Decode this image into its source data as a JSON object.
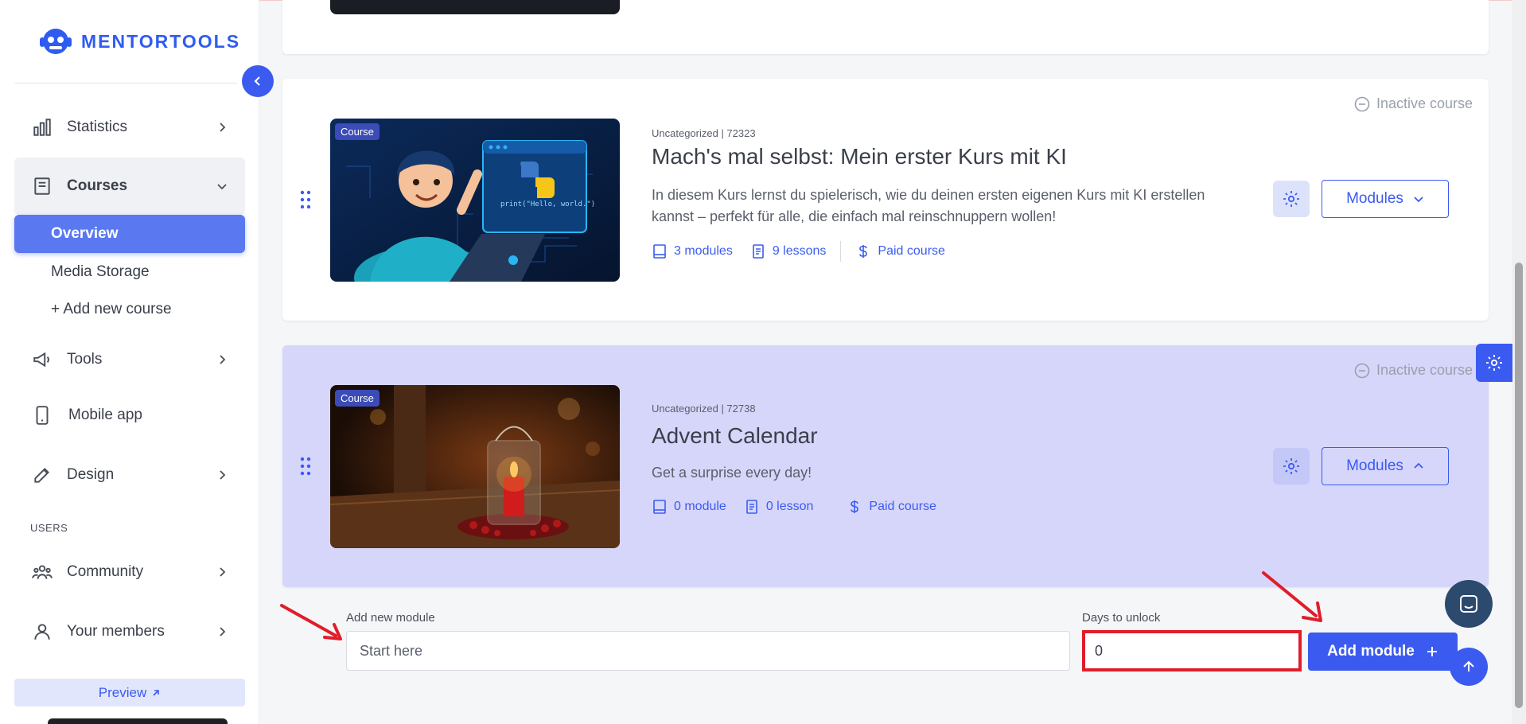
{
  "brand": {
    "name": "MENTORTOOLS",
    "color": "#2f5cf0"
  },
  "sidebar": {
    "items": [
      {
        "label": "Statistics",
        "icon": "bar-chart-icon"
      },
      {
        "label": "Courses",
        "icon": "book-icon"
      },
      {
        "label": "Tools",
        "icon": "megaphone-icon"
      },
      {
        "label": "Mobile app",
        "icon": "smartphone-icon"
      },
      {
        "label": "Design",
        "icon": "pencil-icon"
      },
      {
        "label": "Community",
        "icon": "users-icon"
      },
      {
        "label": "Your members",
        "icon": "user-icon"
      }
    ],
    "courses_sub": {
      "overview": "Overview",
      "media_storage": "Media Storage",
      "add_course": "+ Add new course"
    },
    "section_users": "USERS",
    "preview": "Preview"
  },
  "courses": [
    {
      "badge": "Course",
      "meta": "Uncategorized | 72323",
      "title": "Mach's mal selbst: Mein erster Kurs mit KI",
      "description": "In diesem Kurs lernst du spielerisch, wie du deinen ersten eigenen Kurs mit KI erstellen kannst – perfekt für alle, die einfach mal reinschnuppern wollen!",
      "modules": "3 modules",
      "lessons": "9 lessons",
      "price": "Paid course",
      "status": "Inactive course",
      "modules_button": "Modules",
      "code_text": "print(\"Hello, world.\")"
    },
    {
      "badge": "Course",
      "meta": "Uncategorized | 72738",
      "title": "Advent Calendar",
      "description": "Get a surprise every day!",
      "modules": "0 module",
      "lessons": "0 lesson",
      "price": "Paid course",
      "status": "Inactive course",
      "modules_button": "Modules"
    }
  ],
  "add_module": {
    "name_label": "Add new module",
    "name_placeholder": "Start here",
    "days_label": "Days to unlock",
    "days_value": "0",
    "button": "Add module"
  },
  "colors": {
    "accent": "#3b5bf0",
    "highlight": "#d6d6fb",
    "annotation_red": "#e11d2a"
  }
}
